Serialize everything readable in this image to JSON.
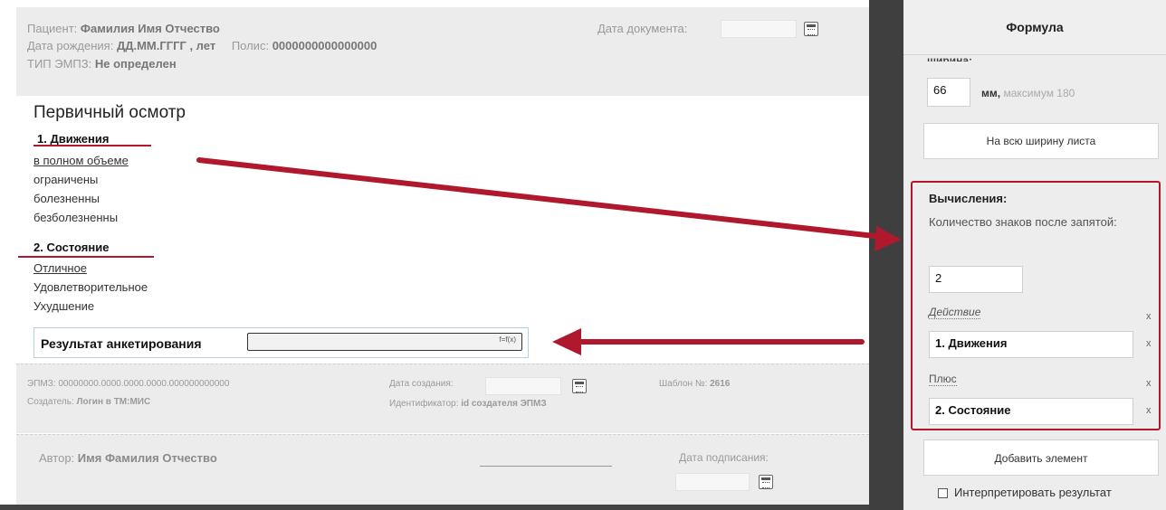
{
  "header": {
    "patient_label": "Пациент:",
    "patient_value": "Фамилия Имя Отчество",
    "dob_label": "Дата рождения:",
    "dob_value": "ДД.ММ.ГГГГ , лет",
    "policy_label": "Полис:",
    "policy_value": "0000000000000000",
    "type_label": "ТИП ЭМПЗ:",
    "type_value": "Не определен",
    "doc_date_label": "Дата документа:"
  },
  "form": {
    "section_title": "Первичный осмотр",
    "group1_title": "1. Движения",
    "group1_options": [
      "в полном объеме",
      "ограничены",
      "болезненны",
      "безболезненны"
    ],
    "group2_title": "2. Состояние",
    "group2_options": [
      "Отличное",
      "Удовлетворительное",
      "Ухудшение"
    ],
    "result_label": "Результат анкетирования",
    "result_fx": "f=f(x)"
  },
  "footer": {
    "emz_label": "ЭПМЗ:",
    "emz_value": "00000000.0000.0000.0000.000000000000",
    "creator_label": "Создатель:",
    "creator_value": "Логин в ТМ:МИС",
    "created_date_label": "Дата создания:",
    "identifier_label": "Идентификатор:",
    "identifier_value": "id создателя ЭПМЗ",
    "template_label": "Шаблон №:",
    "template_value": "2616",
    "author_label": "Автор:",
    "author_value": "Имя Фамилия Отчество",
    "signed_date_label": "Дата подписания:"
  },
  "panel": {
    "title": "Формула",
    "width_label": "ширина:",
    "width_value": "66",
    "width_unit": "мм,",
    "width_max": "максимум 180",
    "full_width_button": "На всю ширину листа",
    "calc_title": "Вычисления:",
    "decimals_label": "Количество знаков после запятой:",
    "decimals_value": "2",
    "action_label": "Действие",
    "action_value": "1. Движения",
    "plus_label": "Плюс",
    "plus_value": "2. Состояние",
    "remove_symbol": "x",
    "add_element_button": "Добавить элемент",
    "interpret_label": "Интерпретировать результат"
  },
  "colors": {
    "accent_red": "#b0182e",
    "gutter": "#3f3f3f",
    "panel_bg": "#ededed"
  }
}
